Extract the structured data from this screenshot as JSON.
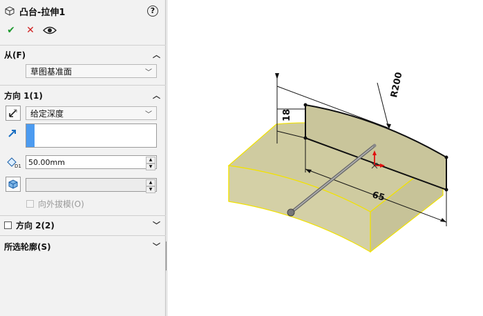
{
  "feature": {
    "title": "凸台-拉伸1",
    "help": "?"
  },
  "actions": {
    "ok": "✔",
    "cancel": "✕"
  },
  "from": {
    "header": "从(F)",
    "selected": "草图基准面"
  },
  "direction1": {
    "header": "方向 1(1)",
    "end_condition": "给定深度",
    "depth_value": "50.00mm",
    "draft_value": "",
    "outward_draft_label": "向外拔模(O)"
  },
  "direction2": {
    "header": "方向 2(2)"
  },
  "contours": {
    "header": "所选轮廓(S)"
  },
  "viewport": {
    "dim_height": "18",
    "dim_radius": "R200",
    "dim_length": "65"
  },
  "colors": {
    "face": "#cfcba0",
    "edge_highlight": "#f2e200",
    "accent": "#4c9bf0"
  }
}
